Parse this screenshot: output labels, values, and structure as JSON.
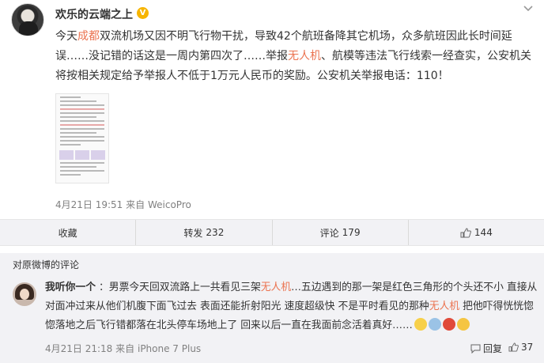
{
  "post": {
    "username": "欢乐的云端之上",
    "badge": "V",
    "menu_icon": "chevron-down-icon",
    "text_segments": [
      {
        "text": "今天",
        "highlight": false
      },
      {
        "text": "成都",
        "highlight": true
      },
      {
        "text": "双流机场又因不明飞行物干扰，导致42个航班备降其它机场，众多航班因此长时间延误……没记错的话这是一周内第四次了……举报",
        "highlight": false
      },
      {
        "text": "无人机",
        "highlight": true
      },
      {
        "text": "、航模等违法飞行线索一经查实，公安机关将按相关规定给予举报人不低于1万元人民币的奖励。公安机关举报电话：110！",
        "highlight": false
      }
    ],
    "time": "4月21日 19:51",
    "source_prefix": "来自",
    "source": "WeicoPro"
  },
  "actions": {
    "favorite_label": "收藏",
    "repost_label": "转发",
    "repost_count": "232",
    "comment_label": "评论",
    "comment_count": "179",
    "like_count": "144"
  },
  "comments": {
    "header": "对原微博的评论",
    "items": [
      {
        "name": "我听你一个",
        "colon": "：",
        "segments": [
          {
            "text": "男票今天回双流路上一共看见三架",
            "highlight": false
          },
          {
            "text": "无人机",
            "highlight": true
          },
          {
            "text": "…五边遇到的那一架是红色三角形的个头还不小 直接从对面冲过来从他们机腹下面飞过去 表面还能折射阳光 速度超级快 不是平时看见的那种",
            "highlight": false
          },
          {
            "text": "无人机",
            "highlight": true
          },
          {
            "text": " 把他吓得恍恍惚惚落地之后飞行错都落在北头停车场地上了 回来以后一直在我面前念活着真好……",
            "highlight": false
          }
        ],
        "time": "4月21日 21:18",
        "source_prefix": "来自",
        "source": "iPhone 7 Plus",
        "reply_label": "回复",
        "like_count": "37"
      }
    ]
  },
  "colors": {
    "highlight": "#eb7350",
    "meta": "#808080",
    "panel_bg": "#f2f2f5"
  }
}
